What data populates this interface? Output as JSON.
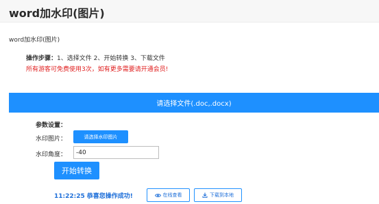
{
  "header": {
    "title": "word加水印(图片)"
  },
  "subtitle": "word加水印(图片)",
  "steps": {
    "label": "操作步骤：",
    "text": "1、选择文件 2、开始转换 3、下载文件"
  },
  "notice": "所有游客可免费使用3次，如有更多需要请开通会员!",
  "upload": {
    "label": "请选择文件(.doc,.docx)"
  },
  "params": {
    "title": "参数设置：",
    "watermark_image_label": "水印图片：",
    "watermark_image_button": "请选择水印图片",
    "watermark_angle_label": "水印角度：",
    "watermark_angle_value": "-40"
  },
  "convert_button": "开始转换",
  "result": {
    "time": "11:22:25",
    "message": "恭喜您操作成功!",
    "view_online": "在线查看",
    "download_local": "下载到本地"
  },
  "icons": {
    "view": "eye-icon",
    "download": "download-icon"
  },
  "colors": {
    "primary": "#1e90ff",
    "notice_red": "#e02020",
    "success_blue": "#1e6fd9"
  }
}
